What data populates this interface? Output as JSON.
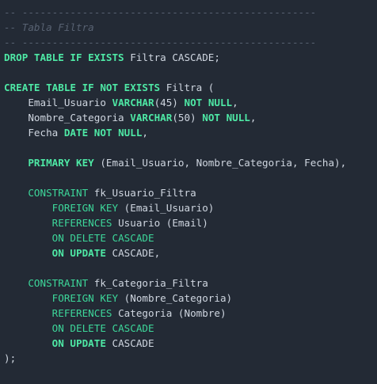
{
  "editor": {
    "background": "#232a35",
    "colors": {
      "comment": "#586272",
      "keyword": "#4ee8a5",
      "keyword_light": "#3dd79a",
      "identifier": "#cfd6e0"
    },
    "lines": [
      [
        {
          "t": "-- -------------------------------------------------",
          "c": "dash"
        }
      ],
      [
        {
          "t": "-- Tabla Filtra",
          "c": "comment"
        }
      ],
      [
        {
          "t": "-- -------------------------------------------------",
          "c": "dash"
        }
      ],
      [
        {
          "t": "DROP TABLE IF EXISTS",
          "c": "kw-bold"
        },
        {
          "t": " Filtra CASCADE;",
          "c": "ident"
        }
      ],
      [],
      [
        {
          "t": "CREATE TABLE IF NOT EXISTS",
          "c": "kw-bold"
        },
        {
          "t": " Filtra (",
          "c": "ident"
        }
      ],
      [
        {
          "t": "    Email_Usuario ",
          "c": "ident"
        },
        {
          "t": "VARCHAR",
          "c": "type"
        },
        {
          "t": "(45) ",
          "c": "ident"
        },
        {
          "t": "NOT NULL",
          "c": "kw-bold"
        },
        {
          "t": ",",
          "c": "ident"
        }
      ],
      [
        {
          "t": "    Nombre_Categoria ",
          "c": "ident"
        },
        {
          "t": "VARCHAR",
          "c": "type"
        },
        {
          "t": "(50) ",
          "c": "ident"
        },
        {
          "t": "NOT NULL",
          "c": "kw-bold"
        },
        {
          "t": ",",
          "c": "ident"
        }
      ],
      [
        {
          "t": "    Fecha ",
          "c": "ident"
        },
        {
          "t": "DATE NOT NULL",
          "c": "kw-bold"
        },
        {
          "t": ",",
          "c": "ident"
        }
      ],
      [],
      [
        {
          "t": "    ",
          "c": "ident"
        },
        {
          "t": "PRIMARY KEY",
          "c": "kw-bold"
        },
        {
          "t": " (Email_Usuario, Nombre_Categoria, Fecha),",
          "c": "ident"
        }
      ],
      [],
      [
        {
          "t": "    ",
          "c": "ident"
        },
        {
          "t": "CONSTRAINT",
          "c": "kw"
        },
        {
          "t": " fk_Usuario_Filtra",
          "c": "ident"
        }
      ],
      [
        {
          "t": "        ",
          "c": "ident"
        },
        {
          "t": "FOREIGN KEY",
          "c": "kw"
        },
        {
          "t": " (Email_Usuario)",
          "c": "ident"
        }
      ],
      [
        {
          "t": "        ",
          "c": "ident"
        },
        {
          "t": "REFERENCES",
          "c": "kw"
        },
        {
          "t": " Usuario (Email)",
          "c": "ident"
        }
      ],
      [
        {
          "t": "        ",
          "c": "ident"
        },
        {
          "t": "ON DELETE CASCADE",
          "c": "kw"
        }
      ],
      [
        {
          "t": "        ",
          "c": "ident"
        },
        {
          "t": "ON UPDATE",
          "c": "kw-bold"
        },
        {
          "t": " CASCADE,",
          "c": "ident"
        }
      ],
      [],
      [
        {
          "t": "    ",
          "c": "ident"
        },
        {
          "t": "CONSTRAINT",
          "c": "kw"
        },
        {
          "t": " fk_Categoria_Filtra",
          "c": "ident"
        }
      ],
      [
        {
          "t": "        ",
          "c": "ident"
        },
        {
          "t": "FOREIGN KEY",
          "c": "kw"
        },
        {
          "t": " (Nombre_Categoria)",
          "c": "ident"
        }
      ],
      [
        {
          "t": "        ",
          "c": "ident"
        },
        {
          "t": "REFERENCES",
          "c": "kw"
        },
        {
          "t": " Categoria (Nombre)",
          "c": "ident"
        }
      ],
      [
        {
          "t": "        ",
          "c": "ident"
        },
        {
          "t": "ON DELETE CASCADE",
          "c": "kw"
        }
      ],
      [
        {
          "t": "        ",
          "c": "ident"
        },
        {
          "t": "ON UPDATE",
          "c": "kw-bold"
        },
        {
          "t": " CASCADE",
          "c": "ident"
        }
      ],
      [
        {
          "t": ");",
          "c": "ident"
        }
      ]
    ]
  }
}
